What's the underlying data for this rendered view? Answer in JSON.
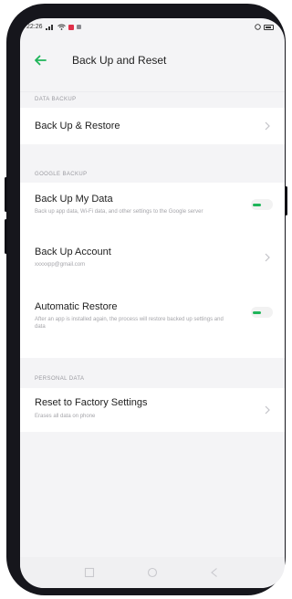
{
  "status_bar": {
    "time": "22:26",
    "icons": [
      "signal-icon",
      "wifi-icon",
      "notification-icon",
      "battery-icon"
    ]
  },
  "header": {
    "back_icon": "back-arrow-icon",
    "title": "Back Up and Reset"
  },
  "sections": {
    "data_backup": "DATA BACKUP",
    "google_backup": "GOOGLE BACKUP",
    "personal_data": "PERSONAL DATA"
  },
  "items": {
    "back_up_restore": {
      "title": "Back Up & Restore"
    },
    "back_up_my_data": {
      "title": "Back Up My Data",
      "subtitle": "Back up app data, Wi-Fi data, and other settings to the Google server",
      "enabled": true
    },
    "back_up_account": {
      "title": "Back Up Account",
      "subtitle": "xxxxxpp@gmail.com"
    },
    "automatic_restore": {
      "title": "Automatic Restore",
      "subtitle": "After an app is installed again, the process will restore backed up settings and data",
      "enabled": true
    },
    "reset_factory": {
      "title": "Reset to Factory Settings",
      "subtitle": "Erases all data on phone"
    }
  },
  "colors": {
    "accent": "#1fb55a",
    "background": "#f4f4f6",
    "card": "#ffffff"
  }
}
